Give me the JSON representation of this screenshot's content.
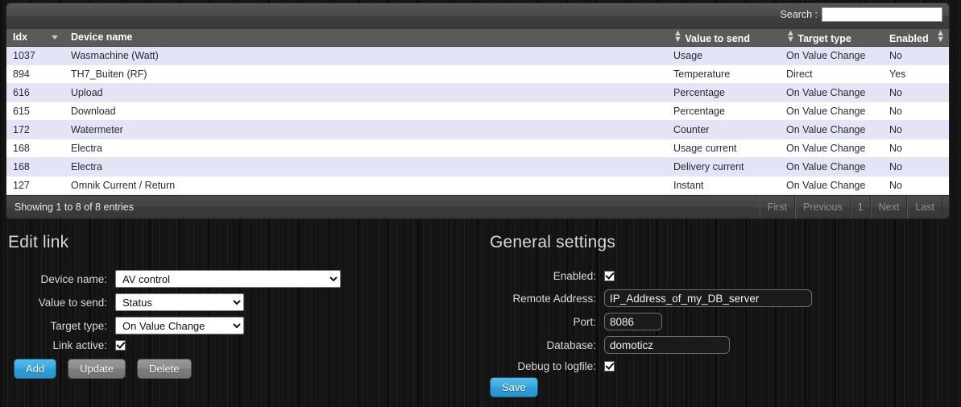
{
  "table": {
    "search": {
      "label": "Search :",
      "value": "",
      "placeholder": ""
    },
    "columns": [
      {
        "key": "idx",
        "label": "Idx",
        "sort": "desc"
      },
      {
        "key": "device",
        "label": "Device name",
        "sort": "none"
      },
      {
        "key": "value",
        "label": "Value to send",
        "sort": "both"
      },
      {
        "key": "target",
        "label": "Target type",
        "sort": "both"
      },
      {
        "key": "enabled",
        "label": "Enabled",
        "sort": "both"
      }
    ],
    "rows": [
      {
        "idx": "1037",
        "device": "Wasmachine (Watt)",
        "value": "Usage",
        "target": "On Value Change",
        "enabled": "No"
      },
      {
        "idx": "894",
        "device": "TH7_Buiten (RF)",
        "value": "Temperature",
        "target": "Direct",
        "enabled": "Yes"
      },
      {
        "idx": "616",
        "device": "Upload",
        "value": "Percentage",
        "target": "On Value Change",
        "enabled": "No"
      },
      {
        "idx": "615",
        "device": "Download",
        "value": "Percentage",
        "target": "On Value Change",
        "enabled": "No"
      },
      {
        "idx": "172",
        "device": "Watermeter",
        "value": "Counter",
        "target": "On Value Change",
        "enabled": "No"
      },
      {
        "idx": "168",
        "device": "Electra",
        "value": "Usage current",
        "target": "On Value Change",
        "enabled": "No"
      },
      {
        "idx": "168",
        "device": "Electra",
        "value": "Delivery current",
        "target": "On Value Change",
        "enabled": "No"
      },
      {
        "idx": "127",
        "device": "Omnik Current / Return",
        "value": "Instant",
        "target": "On Value Change",
        "enabled": "No"
      }
    ],
    "footer": {
      "info": "Showing 1 to 8 of 8 entries",
      "pager": [
        "First",
        "Previous",
        "1",
        "Next",
        "Last"
      ]
    }
  },
  "edit_link": {
    "title": "Edit link",
    "device_name": {
      "label": "Device name:",
      "value": "AV control"
    },
    "value_to_send": {
      "label": "Value to send:",
      "value": "Status"
    },
    "target_type": {
      "label": "Target type:",
      "value": "On Value Change"
    },
    "link_active": {
      "label": "Link active:",
      "checked": true
    },
    "buttons": {
      "add": "Add",
      "update": "Update",
      "delete": "Delete"
    }
  },
  "general_settings": {
    "title": "General settings",
    "enabled": {
      "label": "Enabled:",
      "checked": true
    },
    "remote_address": {
      "label": "Remote Address:",
      "value": "IP_Address_of_my_DB_server"
    },
    "port": {
      "label": "Port:",
      "value": "8086"
    },
    "database": {
      "label": "Database:",
      "value": "domoticz"
    },
    "debug_to_logfile": {
      "label": "Debug to logfile:",
      "checked": true
    },
    "save_button": "Save"
  },
  "colors": {
    "accent_blue": "#3ba7dd",
    "row_odd": "#e4e4f7",
    "row_even": "#ffffff",
    "header_grey": "#5a5a5a",
    "page_bg": "#141414"
  }
}
